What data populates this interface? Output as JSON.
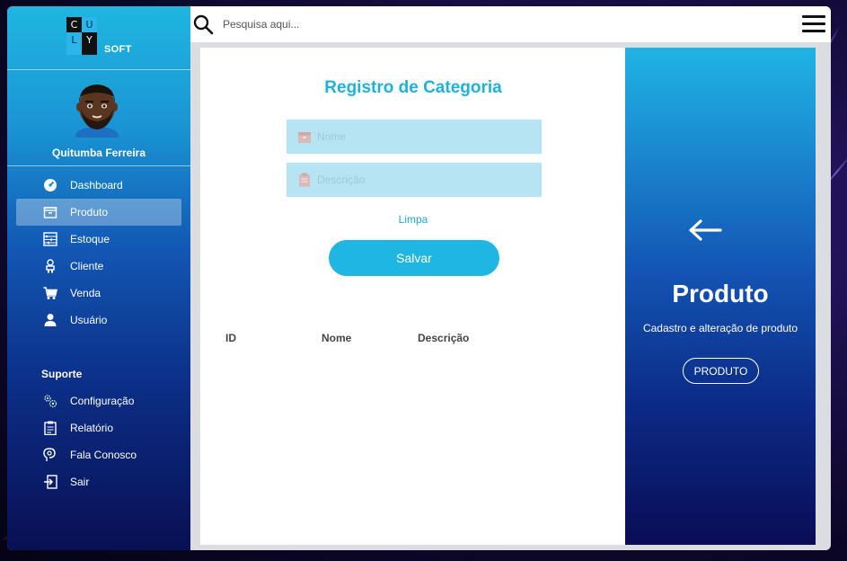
{
  "logo": {
    "letters": [
      "C",
      "U",
      "L",
      "Y"
    ],
    "suffix": "SOFT"
  },
  "user": {
    "name": "Quitumba Ferreira"
  },
  "sidebar": {
    "items": [
      {
        "label": "Dashboard",
        "icon": "speedometer-icon"
      },
      {
        "label": "Produto",
        "icon": "box-icon",
        "active": true
      },
      {
        "label": "Estoque",
        "icon": "abacus-icon"
      },
      {
        "label": "Cliente",
        "icon": "person-icon"
      },
      {
        "label": "Venda",
        "icon": "cart-icon"
      },
      {
        "label": "Usuário",
        "icon": "user-icon"
      }
    ],
    "support_title": "Suporte",
    "support_items": [
      {
        "label": "Configuração",
        "icon": "gears-icon"
      },
      {
        "label": "Relatório",
        "icon": "report-icon"
      },
      {
        "label": "Fala Conosco",
        "icon": "chat-icon"
      },
      {
        "label": "Sair",
        "icon": "exit-icon"
      }
    ]
  },
  "search": {
    "placeholder": "Pesquisa aqui..."
  },
  "form": {
    "title": "Registro de Categoria",
    "name_placeholder": "Nome",
    "description_placeholder": "Descrição",
    "clear_label": "Limpa",
    "save_label": "Salvar"
  },
  "table": {
    "columns": [
      "ID",
      "Nome",
      "Descrição"
    ]
  },
  "panel": {
    "title": "Produto",
    "subtitle": "Cadastro e alteração de produto",
    "button_label": "PRODUTO"
  },
  "colors": {
    "accent": "#1fb1dd",
    "field_bg": "#b6e4f3",
    "sidebar_top": "#1fb6e0",
    "sidebar_bottom": "#0a0f52"
  }
}
